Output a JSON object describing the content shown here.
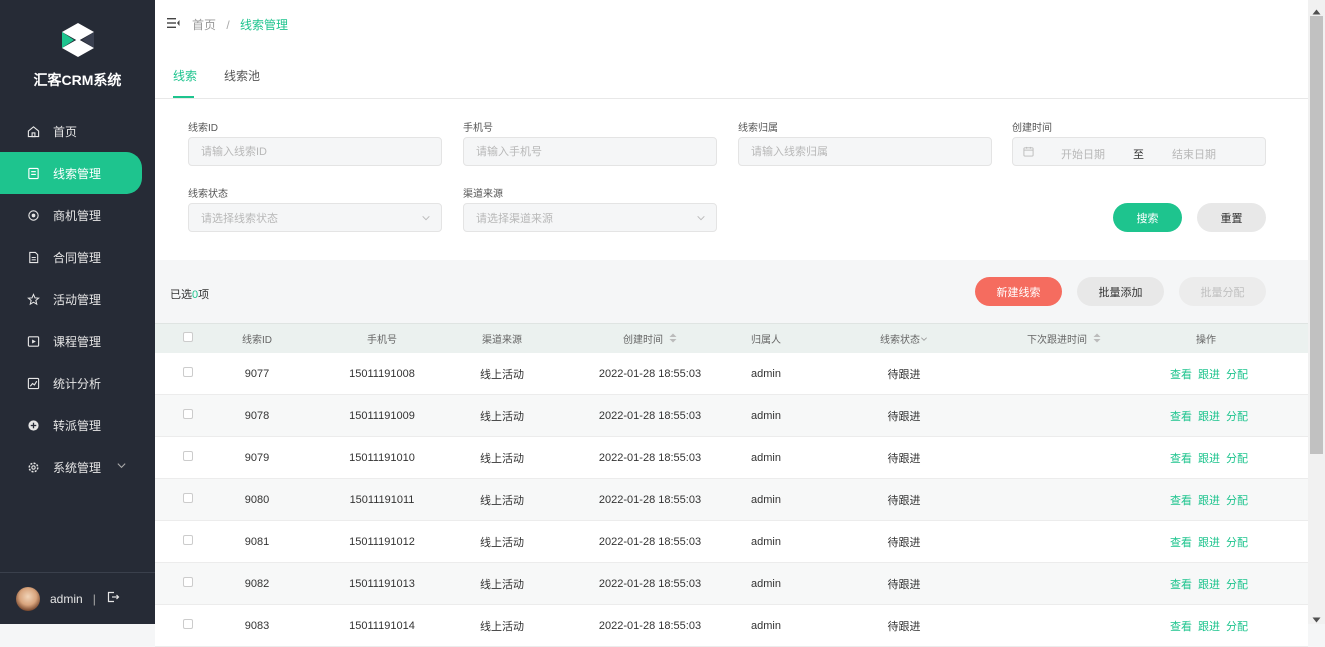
{
  "app": {
    "title": "汇客CRM系统"
  },
  "sidebar": {
    "items": [
      {
        "label": "首页",
        "icon": "home-icon",
        "active": false
      },
      {
        "label": "线索管理",
        "icon": "clipboard-icon",
        "active": true
      },
      {
        "label": "商机管理",
        "icon": "target-icon",
        "active": false
      },
      {
        "label": "合同管理",
        "icon": "document-icon",
        "active": false
      },
      {
        "label": "活动管理",
        "icon": "star-icon",
        "active": false
      },
      {
        "label": "课程管理",
        "icon": "video-icon",
        "active": false
      },
      {
        "label": "统计分析",
        "icon": "chart-icon",
        "active": false
      },
      {
        "label": "转派管理",
        "icon": "transfer-icon",
        "active": false
      },
      {
        "label": "系统管理",
        "icon": "gear-icon",
        "active": false
      }
    ],
    "user": {
      "name": "admin",
      "separator": "|"
    }
  },
  "breadcrumb": {
    "home": "首页",
    "sep": "/",
    "current": "线索管理"
  },
  "tabs": [
    "线索",
    "线索池"
  ],
  "filters": {
    "clue_id": {
      "label": "线索ID",
      "placeholder": "请输入线索ID"
    },
    "phone": {
      "label": "手机号",
      "placeholder": "请输入手机号"
    },
    "owner": {
      "label": "线索归属",
      "placeholder": "请输入线索归属"
    },
    "created": {
      "label": "创建时间",
      "start": "开始日期",
      "to": "至",
      "end": "结束日期"
    },
    "status": {
      "label": "线索状态",
      "placeholder": "请选择线索状态"
    },
    "channel": {
      "label": "渠道来源",
      "placeholder": "请选择渠道来源"
    },
    "search_label": "搜索",
    "reset_label": "重置"
  },
  "toolbar": {
    "selected_prefix": "已选",
    "selected_count": "0",
    "selected_suffix": "项",
    "new_label": "新建线索",
    "batch_add_label": "批量添加",
    "batch_assign_label": "批量分配"
  },
  "table": {
    "columns": [
      "线索ID",
      "手机号",
      "渠道来源",
      "创建时间",
      "归属人",
      "线索状态",
      "下次跟进时间",
      "操作"
    ],
    "actions": [
      "查看",
      "跟进",
      "分配"
    ],
    "rows": [
      {
        "id": "9077",
        "phone": "15011191008",
        "channel": "线上活动",
        "created": "2022-01-28 18:55:03",
        "owner": "admin",
        "status": "待跟进",
        "next": ""
      },
      {
        "id": "9078",
        "phone": "15011191009",
        "channel": "线上活动",
        "created": "2022-01-28 18:55:03",
        "owner": "admin",
        "status": "待跟进",
        "next": ""
      },
      {
        "id": "9079",
        "phone": "15011191010",
        "channel": "线上活动",
        "created": "2022-01-28 18:55:03",
        "owner": "admin",
        "status": "待跟进",
        "next": ""
      },
      {
        "id": "9080",
        "phone": "15011191011",
        "channel": "线上活动",
        "created": "2022-01-28 18:55:03",
        "owner": "admin",
        "status": "待跟进",
        "next": ""
      },
      {
        "id": "9081",
        "phone": "15011191012",
        "channel": "线上活动",
        "created": "2022-01-28 18:55:03",
        "owner": "admin",
        "status": "待跟进",
        "next": ""
      },
      {
        "id": "9082",
        "phone": "15011191013",
        "channel": "线上活动",
        "created": "2022-01-28 18:55:03",
        "owner": "admin",
        "status": "待跟进",
        "next": ""
      },
      {
        "id": "9083",
        "phone": "15011191014",
        "channel": "线上活动",
        "created": "2022-01-28 18:55:03",
        "owner": "admin",
        "status": "待跟进",
        "next": ""
      }
    ]
  },
  "colors": {
    "accent": "#1ec48e",
    "danger": "#f56c5f",
    "sidebar": "#262b36"
  }
}
